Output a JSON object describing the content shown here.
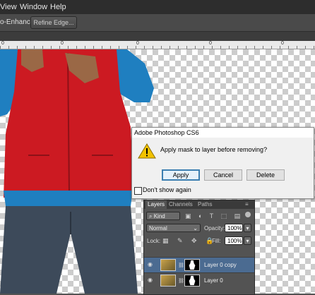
{
  "menu": {
    "items": [
      "View",
      "Window",
      "Help"
    ]
  },
  "options_bar": {
    "auto_enhance": "o-Enhance",
    "refine_edge": "Refine Edge..."
  },
  "ruler": {
    "labels": [
      "0",
      "0",
      "0",
      "0",
      "0"
    ]
  },
  "dialog": {
    "title": "Adobe Photoshop CS6",
    "message": "Apply mask to layer before removing?",
    "buttons": {
      "apply": "Apply",
      "cancel": "Cancel",
      "delete": "Delete"
    },
    "checkbox_label": "Don't show again",
    "icon": "warning-icon"
  },
  "layers_panel": {
    "tabs": [
      "Layers",
      "Channels",
      "Paths"
    ],
    "filter_kind": "Kind",
    "blend_mode": "Normal",
    "opacity_label": "Opacity:",
    "opacity_value": "100%",
    "lock_label": "Lock:",
    "fill_label": "Fill:",
    "fill_value": "100%",
    "layers": [
      {
        "name": "Layer 0 copy",
        "selected": true
      },
      {
        "name": "Layer 0",
        "selected": false
      }
    ]
  },
  "colors": {
    "accent": "#4b6b91",
    "jacket": "#cc1a22",
    "sleeve": "#1f7fc0"
  }
}
